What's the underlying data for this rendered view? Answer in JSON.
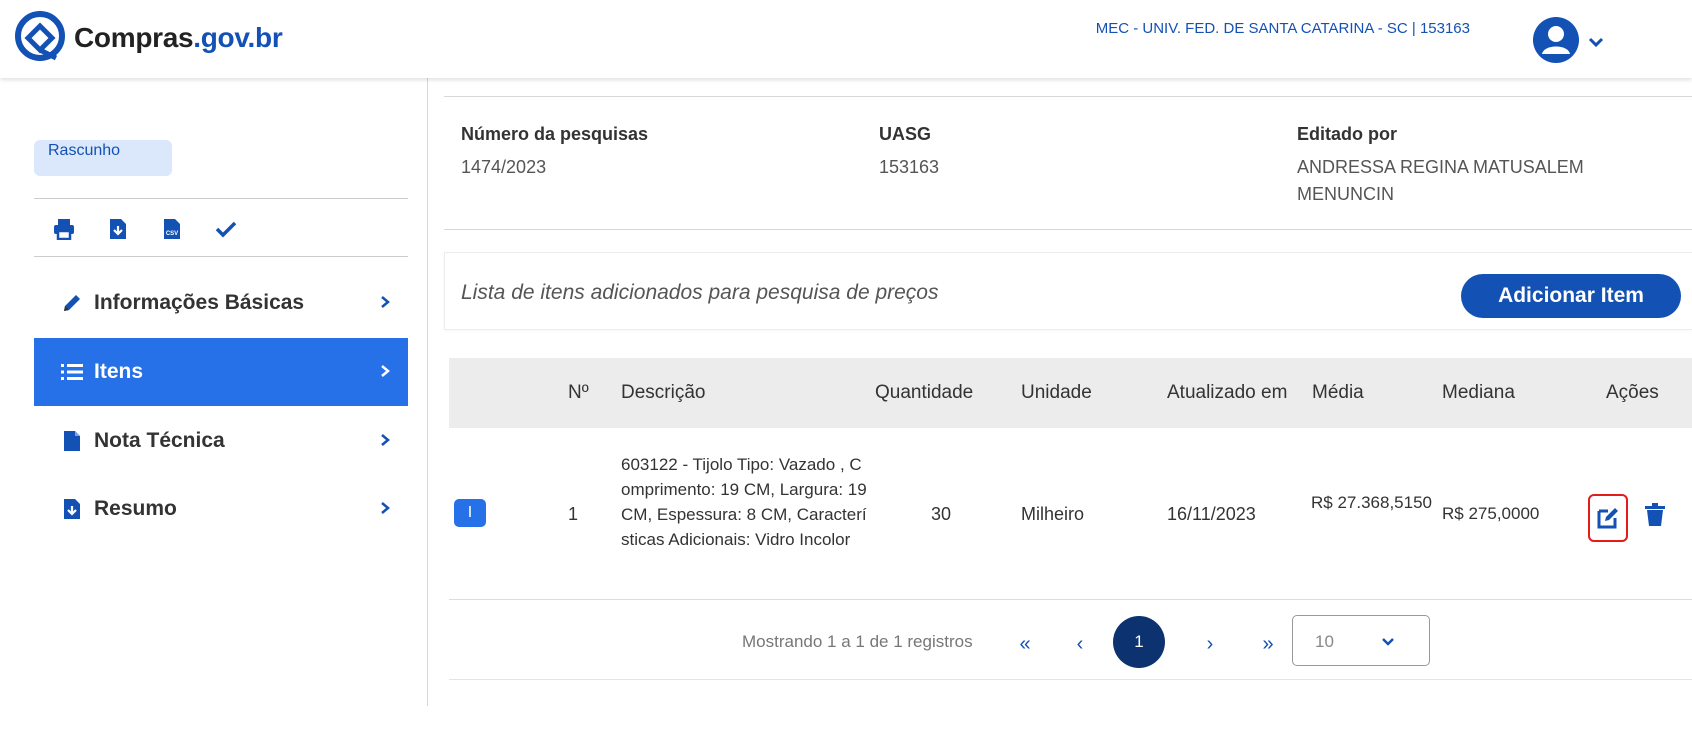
{
  "header": {
    "logo_text_main": "Compras",
    "logo_text_gov": ".gov.br",
    "org_label": "MEC - UNIV. FED. DE SANTA CATARINA - SC | 153163"
  },
  "sidebar": {
    "status_tag": "Rascunho",
    "toolbar": [
      "print-icon",
      "download-icon",
      "csv-icon",
      "check-icon"
    ],
    "items": [
      {
        "label": "Informações Básicas",
        "icon": "pencil-icon",
        "active": false
      },
      {
        "label": "Itens",
        "icon": "list-icon",
        "active": true
      },
      {
        "label": "Nota Técnica",
        "icon": "file-icon",
        "active": false
      },
      {
        "label": "Resumo",
        "icon": "file-download-icon",
        "active": false
      }
    ]
  },
  "info": {
    "numero_label": "Número da pesquisas",
    "numero_value": "1474/2023",
    "uasg_label": "UASG",
    "uasg_value": "153163",
    "editado_label": "Editado por",
    "editado_value": "ANDRESSA REGINA MATUSALEM MENUNCIN"
  },
  "list": {
    "title": "Lista de itens adicionados para pesquisa de preços",
    "add_button": "Adicionar Item"
  },
  "table": {
    "headers": [
      "Nº",
      "Descrição",
      "Quantidade",
      "Unidade",
      "Atualizado em",
      "Média",
      "Mediana",
      "Ações"
    ],
    "rows": [
      {
        "badge": "I",
        "numero": "1",
        "descricao": "603122 - Tijolo Tipo: Vazado , Comprimento: 19 CM, Largura: 19 CM, Espessura: 8 CM, Características Adicionais: Vidro Incolor",
        "quantidade": "30",
        "unidade": "Milheiro",
        "atualizado": "16/11/2023",
        "media": "R$ 27.368,5150",
        "mediana": "R$ 275,0000"
      }
    ]
  },
  "pagination": {
    "summary": "Mostrando 1 a 1 de 1 registros",
    "first": "«",
    "prev": "‹",
    "current": "1",
    "next": "›",
    "last": "»",
    "page_size": "10"
  },
  "colors": {
    "brand_blue": "#1351b4",
    "active_blue": "#2670e8",
    "dark_blue": "#0c326f",
    "highlight_red": "#e31b1b"
  }
}
